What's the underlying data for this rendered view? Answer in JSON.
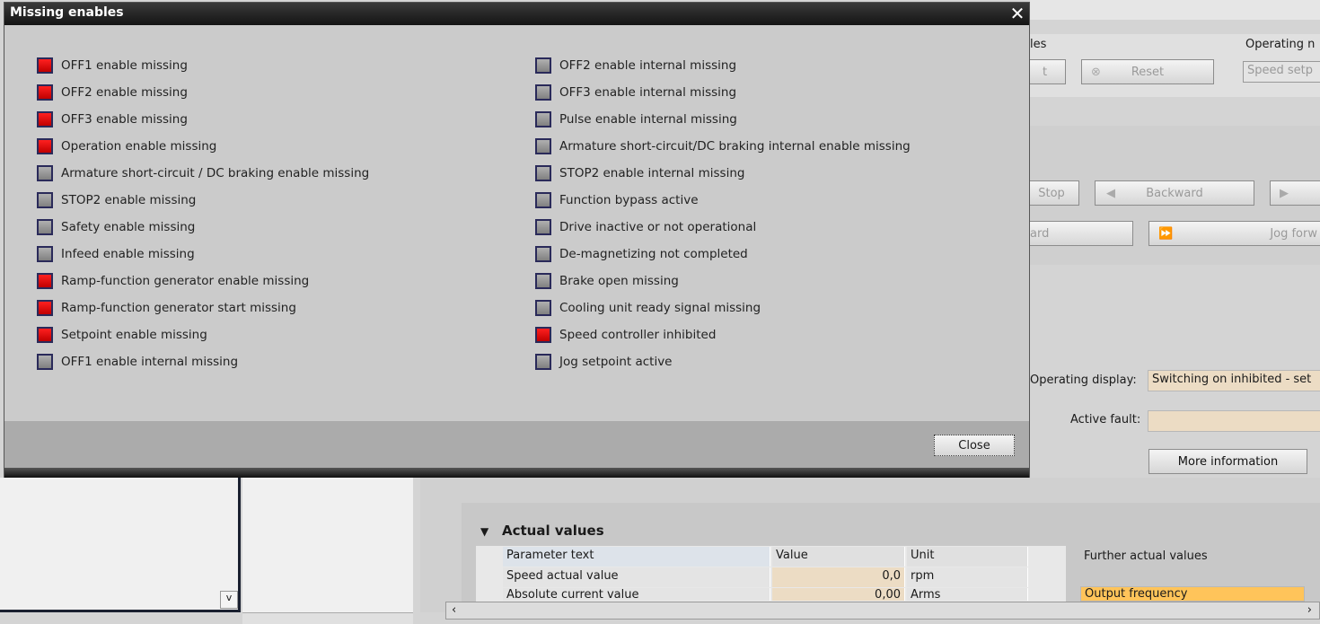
{
  "dialog": {
    "title": "Missing enables",
    "close_label": "Close",
    "colors": {
      "active": "#e00000",
      "inactive": "#999999"
    },
    "left_items": [
      {
        "label": "OFF1 enable missing",
        "active": true
      },
      {
        "label": "OFF2 enable missing",
        "active": true
      },
      {
        "label": "OFF3 enable missing",
        "active": true
      },
      {
        "label": "Operation enable missing",
        "active": true
      },
      {
        "label": "Armature short-circuit / DC braking enable missing",
        "active": false
      },
      {
        "label": "STOP2 enable missing",
        "active": false
      },
      {
        "label": "Safety enable missing",
        "active": false
      },
      {
        "label": "Infeed enable missing",
        "active": false
      },
      {
        "label": "Ramp-function generator enable missing",
        "active": true
      },
      {
        "label": "Ramp-function generator start missing",
        "active": true
      },
      {
        "label": "Setpoint enable missing",
        "active": true
      },
      {
        "label": "OFF1 enable internal missing",
        "active": false
      }
    ],
    "right_items": [
      {
        "label": "OFF2 enable internal missing",
        "active": false
      },
      {
        "label": "OFF3 enable internal missing",
        "active": false
      },
      {
        "label": "Pulse enable internal missing",
        "active": false
      },
      {
        "label": "Armature short-circuit/DC braking internal enable missing",
        "active": false
      },
      {
        "label": "STOP2 enable internal missing",
        "active": false
      },
      {
        "label": "Function bypass active",
        "active": false
      },
      {
        "label": "Drive inactive or not operational",
        "active": false
      },
      {
        "label": "De-magnetizing not completed",
        "active": false
      },
      {
        "label": "Brake open missing",
        "active": false
      },
      {
        "label": "Cooling unit ready signal missing",
        "active": false
      },
      {
        "label": "Speed controller inhibited",
        "active": true
      },
      {
        "label": "Jog setpoint active",
        "active": false
      }
    ]
  },
  "background": {
    "enables_fragment": "les",
    "operating_mode_fragment": "Operating n",
    "btn_t": "t",
    "reset": "Reset",
    "speed_setpoint_fragment": "Speed setp",
    "stop_fragment": "Stop",
    "backward": "Backward",
    "ard_fragment": "ard",
    "jog_forward_fragment": "Jog forw",
    "operating_display_label": "Operating display:",
    "operating_display_value": "Switching on inhibited - set",
    "active_fault_label": "Active fault:",
    "active_fault_value": "",
    "more_info": "More information",
    "actual_values_title": "Actual values",
    "table": {
      "headers": [
        "Parameter text",
        "Value",
        "Unit"
      ],
      "rows": [
        [
          "Speed actual value",
          "0,0",
          "rpm"
        ],
        [
          "Absolute current value",
          "0,00",
          "Arms"
        ]
      ]
    },
    "further_actual_values": "Further actual values",
    "further_select": "Output frequency"
  }
}
